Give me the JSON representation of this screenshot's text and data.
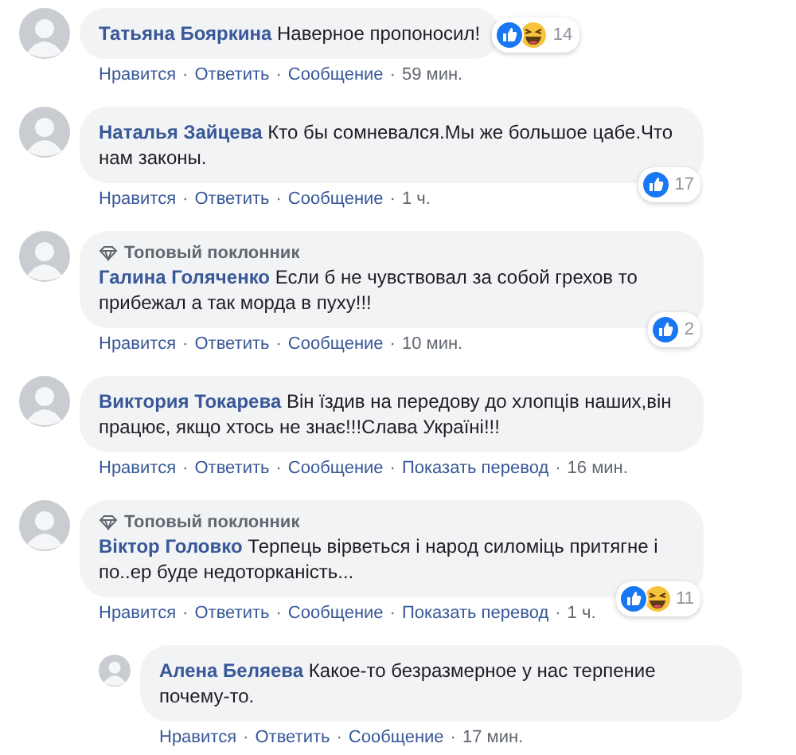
{
  "separator": "·",
  "comments": [
    {
      "name": "Татьяна Бояркина",
      "text": "Наверное пропоносил!",
      "reactions": {
        "icons": [
          {
            "kind": "like"
          },
          {
            "kind": "haha"
          }
        ],
        "count": "14",
        "inline": true
      },
      "actions": [
        "Нравится",
        "Ответить",
        "Сообщение"
      ],
      "time": "59 мин."
    },
    {
      "name": "Наталья Зайцева",
      "text": "Кто бы сомневался.Мы же большое цабе.Что нам законы.",
      "reactions": {
        "icons": [
          {
            "kind": "like"
          }
        ],
        "count": "17",
        "inline": false
      },
      "actions": [
        "Нравится",
        "Ответить",
        "Сообщение"
      ],
      "time": "1 ч."
    },
    {
      "badge": "Топовый поклонник",
      "name": "Галина Голяченко",
      "text": "Если б не чувствовал за собой грехов то прибежал а так морда в пуху!!!",
      "reactions": {
        "icons": [
          {
            "kind": "like"
          }
        ],
        "count": "2",
        "inline": false
      },
      "actions": [
        "Нравится",
        "Ответить",
        "Сообщение"
      ],
      "time": "10 мин."
    },
    {
      "name": "Виктория Токарева",
      "text": "Він їздив на передову до хлопців наших,він працює, якщо хтось не знає!!!Слава Україні!!!",
      "actions": [
        "Нравится",
        "Ответить",
        "Сообщение",
        "Показать перевод"
      ],
      "time": "16 мин."
    },
    {
      "badge": "Топовый поклонник",
      "name": "Віктор Головко",
      "text": "Терпець вірветься і народ силоміць притягне і по..ер буде недоторканість...",
      "reactions": {
        "icons": [
          {
            "kind": "like"
          },
          {
            "kind": "haha"
          }
        ],
        "count": "11",
        "inline": false
      },
      "actions": [
        "Нравится",
        "Ответить",
        "Сообщение",
        "Показать перевод"
      ],
      "time": "1 ч.",
      "replies": [
        {
          "name": "Алена Беляева",
          "text": "Какое-то безразмерное у нас терпение почему-то.",
          "actions": [
            "Нравится",
            "Ответить",
            "Сообщение"
          ],
          "time": "17 мин."
        }
      ]
    }
  ]
}
